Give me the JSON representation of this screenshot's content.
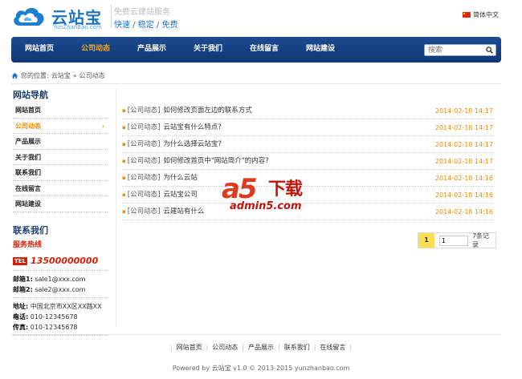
{
  "header": {
    "logo_text": "云站宝",
    "logo_sub": "YunZhanBao.com",
    "slogan_top": "免费云建站服务",
    "slogan_bottom": "快速 / 稳定 / 免费",
    "language": "简体中文"
  },
  "nav": {
    "items": [
      {
        "label": "网站首页"
      },
      {
        "label": "公司动态"
      },
      {
        "label": "产品展示"
      },
      {
        "label": "关于我们"
      },
      {
        "label": "在线留言"
      },
      {
        "label": "网站建设"
      }
    ],
    "active_index": 1,
    "search_placeholder": "搜索"
  },
  "breadcrumb": {
    "prefix": "您的位置:",
    "home": "云站宝",
    "sep": "»",
    "current": "公司动态"
  },
  "sidebar": {
    "title": "网站导航",
    "items": [
      {
        "label": "网站首页"
      },
      {
        "label": "公司动态",
        "arrow": "›"
      },
      {
        "label": "产品展示"
      },
      {
        "label": "关于我们"
      },
      {
        "label": "联系我们"
      },
      {
        "label": "在线留言"
      },
      {
        "label": "网站建设"
      }
    ],
    "contact": {
      "title": "联系我们",
      "hotline_label": "服务热线",
      "tel_badge": "TEL",
      "tel": "13500000000",
      "email1_label": "邮箱1:",
      "email1": "sale1@xxx.com",
      "email2_label": "邮箱2:",
      "email2": "sale2@xxx.com",
      "address_label": "地址:",
      "address": "中国北京市XX区XX路XX栋",
      "phone_label": "电话:",
      "phone": "010-12345678",
      "fax_label": "传真:",
      "fax": "010-12345678"
    }
  },
  "news": [
    {
      "category": "[公司动态]",
      "title": "如何修改页面左边的联系方式",
      "date": "2014-02-18 14:17"
    },
    {
      "category": "[公司动态]",
      "title": "云站宝有什么特点?",
      "date": "2014-02-18 14:17"
    },
    {
      "category": "[公司动态]",
      "title": "为什么选择云站宝?",
      "date": "2014-02-18 14:17"
    },
    {
      "category": "[公司动态]",
      "title": "如何修改首页中\"网站简介\"的内容?",
      "date": "2014-02-18 14:17"
    },
    {
      "category": "[公司动态]",
      "title": "为什么云站",
      "date": "2014-02-18 14:16"
    },
    {
      "category": "[公司动态]",
      "title": "云站宝公司",
      "date": "2014-02-18 14:16"
    },
    {
      "category": "[公司动态]",
      "title": "云建站有什么",
      "date": "2014-02-18 14:16"
    }
  ],
  "pager": {
    "current": "1",
    "input_value": "1",
    "total": "7条记录"
  },
  "watermark": {
    "a5": "a5",
    "download": "下载",
    "url": "admin5.com"
  },
  "footer": {
    "links": [
      {
        "label": "网站首页"
      },
      {
        "label": "公司动态"
      },
      {
        "label": "产品展示"
      },
      {
        "label": "联系我们"
      },
      {
        "label": "在线留言"
      }
    ],
    "separator": "|",
    "copyright": "Powered by 云站宝 v1.0 © 2013-2015 yunzhanbao.com"
  },
  "colors": {
    "nav_bg": "#0f3775",
    "accent": "#f08c00",
    "brand": "#1a73c2",
    "hot": "#d81e06"
  }
}
